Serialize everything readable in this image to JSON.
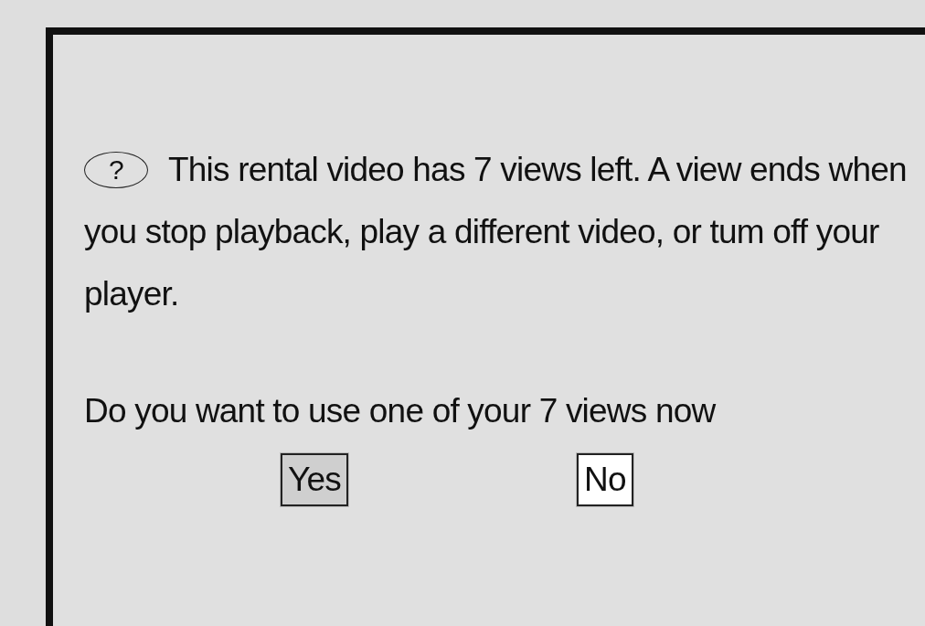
{
  "dialog": {
    "icon": "?",
    "message": "This rental video has 7 views left. A view ends when you stop playback, play a different video, or tum off your player.",
    "question": "Do you want to use one of your 7 views now",
    "buttons": [
      {
        "label": "Yes",
        "selected": true
      },
      {
        "label": "No",
        "selected": false
      }
    ]
  }
}
